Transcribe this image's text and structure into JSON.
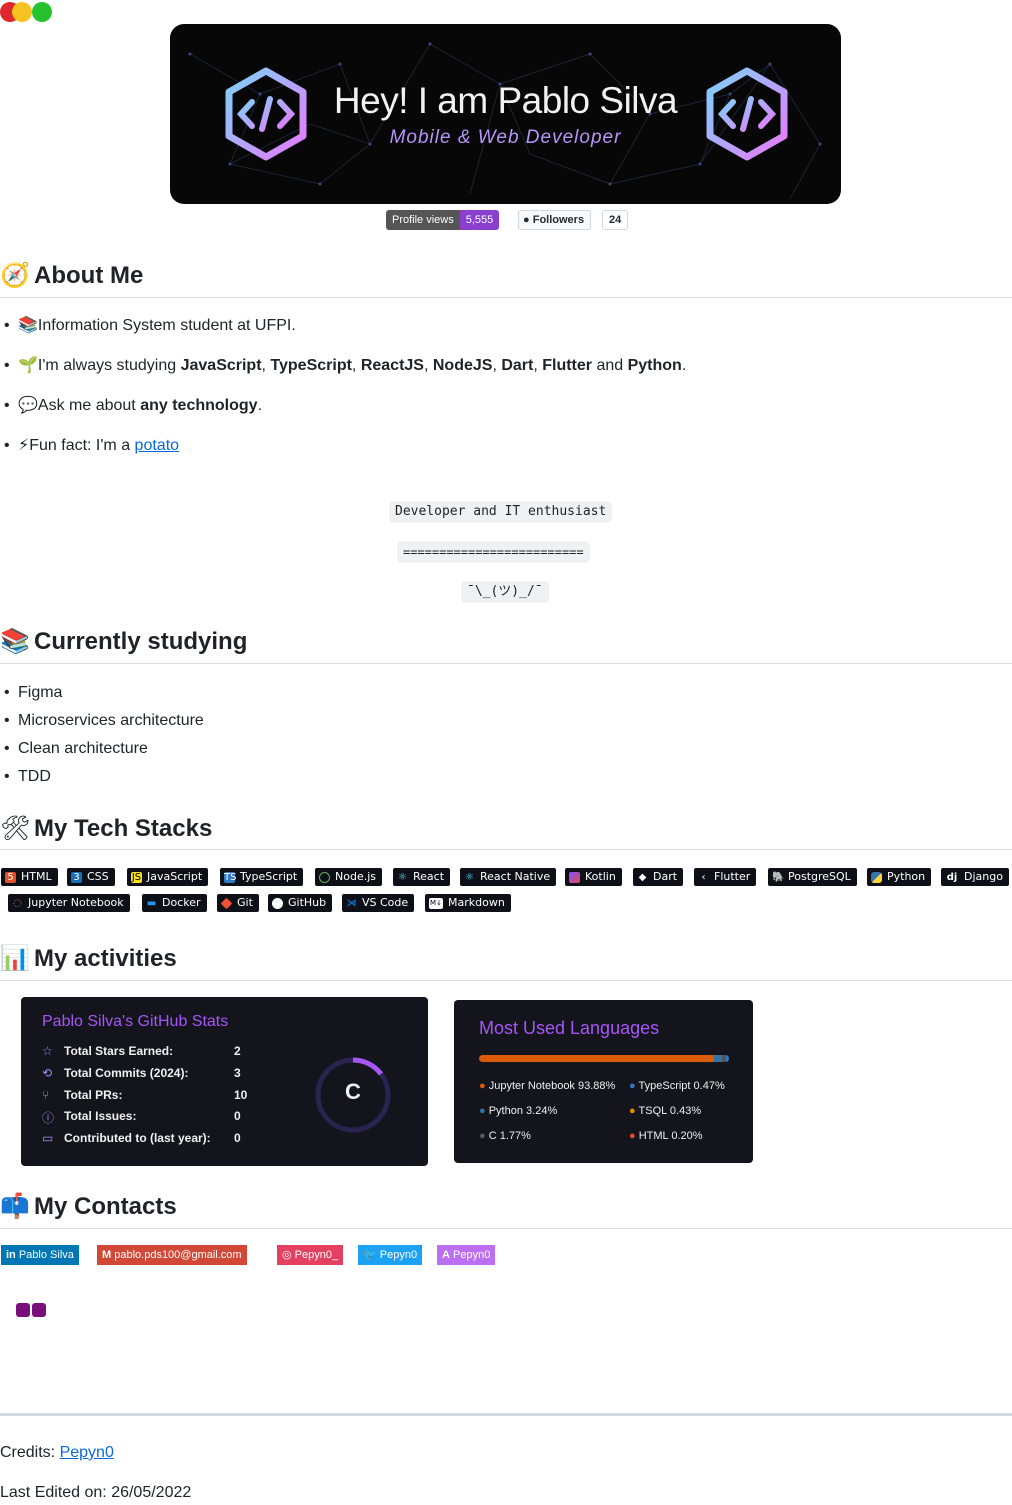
{
  "window": {
    "buttons": [
      "close",
      "minimize",
      "maximize"
    ]
  },
  "banner": {
    "title": "Hey! I am Pablo Silva",
    "subtitle": "Mobile & Web Developer",
    "icon": "code-hexagon-icon"
  },
  "badges": {
    "views_label": "Profile views",
    "views_value": "5,555",
    "followers_label": "Followers",
    "followers_value": "24"
  },
  "about": {
    "heading": "About Me",
    "items": [
      {
        "icon": "books",
        "text": "Information System student at UFPI."
      },
      {
        "icon": "seedling",
        "pre": "I'm always studying ",
        "parts": [
          "JavaScript",
          ", ",
          "TypeScript",
          ", ",
          "ReactJS",
          ", ",
          "NodeJS",
          ", ",
          "Dart",
          ", ",
          "Flutter",
          " and ",
          "Python",
          "."
        ]
      },
      {
        "icon": "speech-bubble",
        "pre": "Ask me about ",
        "bold": "any technology",
        "post": "."
      },
      {
        "icon": "lightning",
        "pre": "Fun fact: I'm a ",
        "link": "potato"
      }
    ],
    "code_lines": [
      "Developer and IT enthusiast",
      "=========================",
      "¯\\_(ツ)_/¯"
    ]
  },
  "studying": {
    "heading": "Currently studying",
    "items": [
      "Figma",
      "Microservices architecture",
      "Clean architecture",
      "TDD"
    ]
  },
  "stack": {
    "heading": "My Tech Stacks",
    "row1": [
      "HTML",
      "CSS",
      "JavaScript",
      "TypeScript",
      "Node.js",
      "React",
      "React Native",
      "Kotlin",
      "Dart",
      "Flutter",
      "PostgreSQL",
      "Python",
      "Django"
    ],
    "row2": [
      "Jupyter Notebook",
      "Docker",
      "Git",
      "GitHub",
      "VS Code",
      "Markdown"
    ]
  },
  "activities": {
    "heading": "My activities",
    "stats": {
      "title": "Pablo Silva's GitHub Stats",
      "rows": [
        {
          "label": "Total Stars Earned:",
          "value": "2"
        },
        {
          "label": "Total Commits (2024):",
          "value": "3"
        },
        {
          "label": "Total PRs:",
          "value": "10"
        },
        {
          "label": "Total Issues:",
          "value": "0"
        },
        {
          "label": "Contributed to (last year):",
          "value": "0"
        }
      ],
      "grade": "C"
    },
    "languages": {
      "title": "Most Used Languages",
      "items": [
        {
          "name": "Jupyter Notebook",
          "pct": "93.88%",
          "color": "#DA5B0B"
        },
        {
          "name": "TypeScript",
          "pct": "0.47%",
          "color": "#3178c6"
        },
        {
          "name": "Python",
          "pct": "3.24%",
          "color": "#3572A5"
        },
        {
          "name": "TSQL",
          "pct": "0.43%",
          "color": "#e38c00"
        },
        {
          "name": "C",
          "pct": "1.77%",
          "color": "#555555"
        },
        {
          "name": "HTML",
          "pct": "0.20%",
          "color": "#e34c26"
        }
      ]
    }
  },
  "contacts": {
    "heading": "My Contacts",
    "items": [
      {
        "label": "Pablo Silva",
        "color": "#0077B5"
      },
      {
        "label": "pablo.pds100@gmail.com",
        "color": "#D14836"
      },
      {
        "label": "Pepyn0_",
        "color": "#E4405F"
      },
      {
        "label": "Pepyn0",
        "color": "#1DA1F2"
      },
      {
        "label": "Pepyn0",
        "color": "#BC6FF1"
      }
    ]
  },
  "footer": {
    "credits_label": "Credits: ",
    "credits_link": "Pepyn0",
    "edited_label": "Last Edited on: 26/05/2022"
  }
}
